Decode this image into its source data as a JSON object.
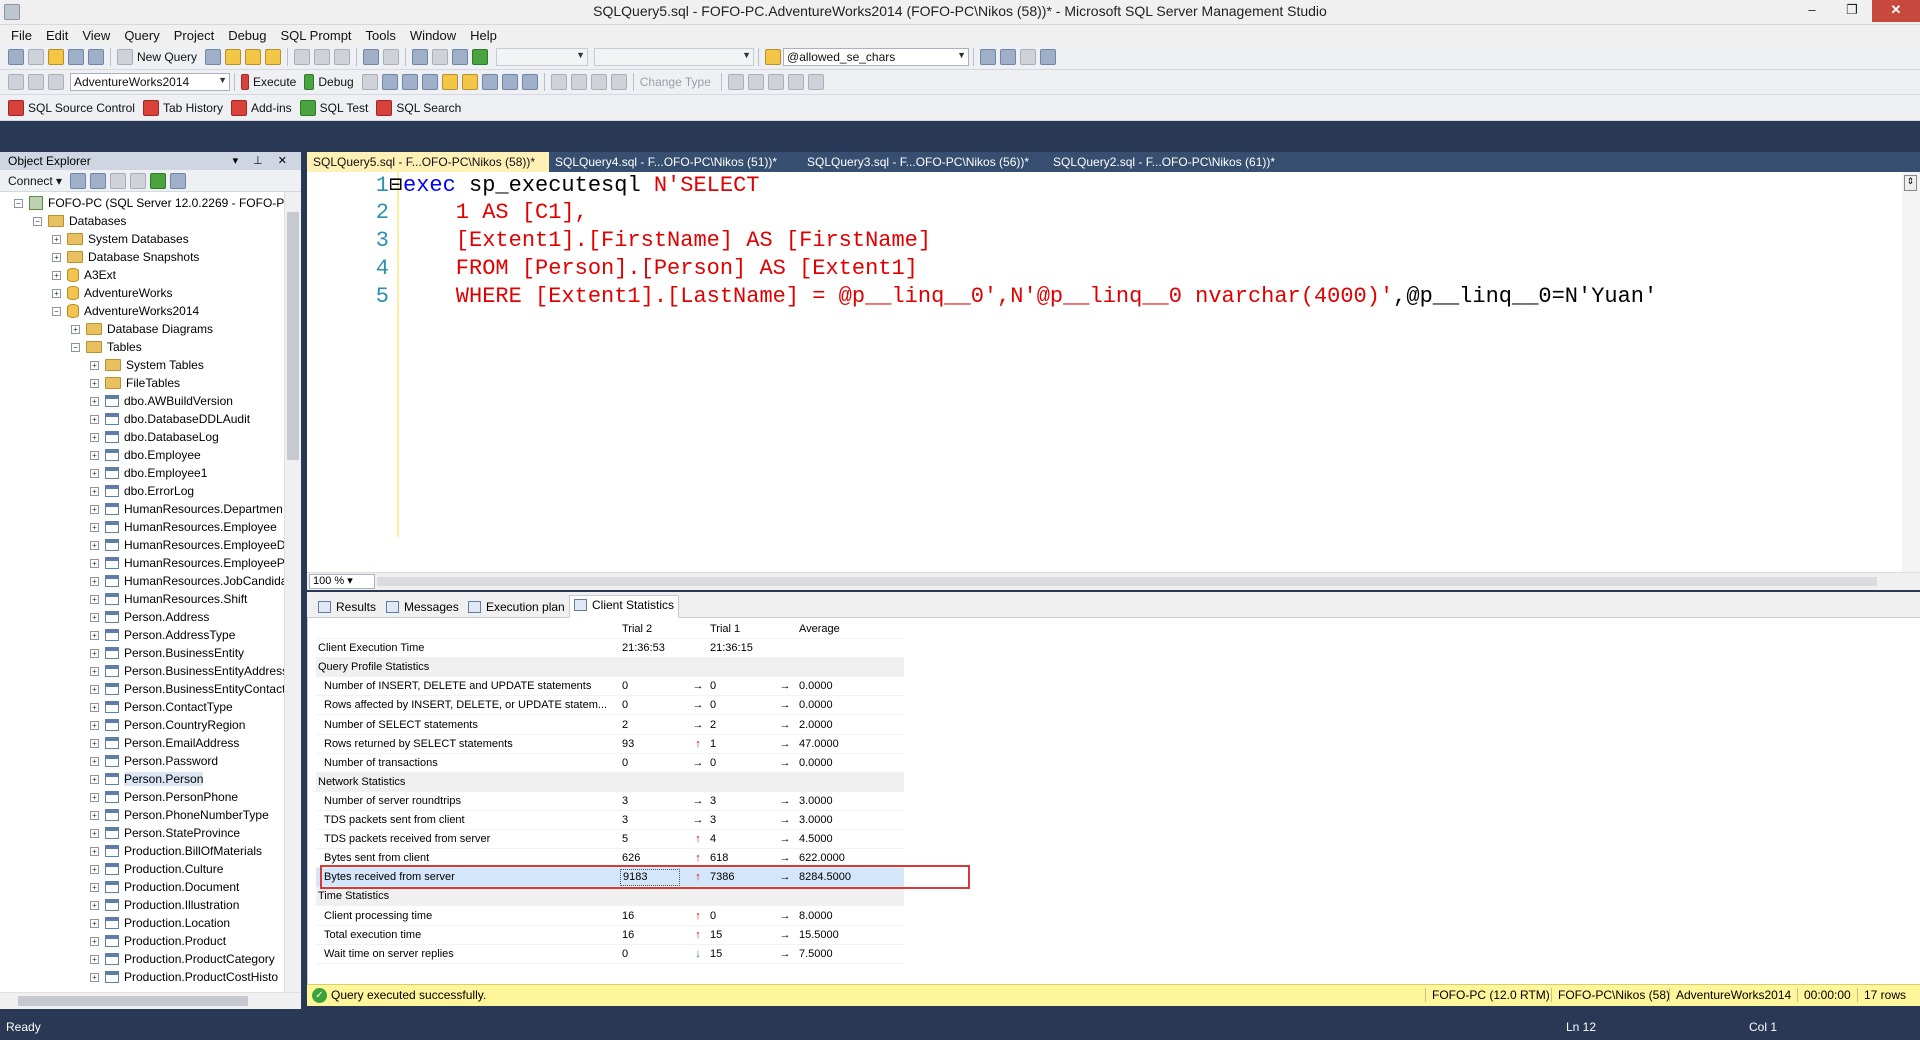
{
  "window": {
    "title": "SQLQuery5.sql - FOFO-PC.AdventureWorks2014 (FOFO-PC\\Nikos (58))* - Microsoft SQL Server Management Studio"
  },
  "menu": [
    "File",
    "Edit",
    "View",
    "Query",
    "Project",
    "Debug",
    "SQL Prompt",
    "Tools",
    "Window",
    "Help"
  ],
  "toolbar1": {
    "new_query": "New Query",
    "search_combo": "@allowed_se_chars"
  },
  "toolbar2": {
    "database": "AdventureWorks2014",
    "execute": "Execute",
    "debug": "Debug",
    "change_type": "Change Type"
  },
  "toolbar3": {
    "source_control": "SQL Source Control",
    "tab_history": "Tab History",
    "addins": "Add-ins",
    "sql_test": "SQL Test",
    "sql_search": "SQL Search"
  },
  "object_explorer": {
    "title": "Object Explorer",
    "connect": "Connect",
    "tree": [
      {
        "label": "FOFO-PC (SQL Server 12.0.2269 - FOFO-PC\\N",
        "level": 0,
        "icon": "server-icon",
        "exp": "−"
      },
      {
        "label": "Databases",
        "level": 1,
        "icon": "folder-icon",
        "exp": "−"
      },
      {
        "label": "System Databases",
        "level": 2,
        "icon": "folder-icon",
        "exp": "+"
      },
      {
        "label": "Database Snapshots",
        "level": 2,
        "icon": "folder-icon",
        "exp": "+"
      },
      {
        "label": "A3Ext",
        "level": 2,
        "icon": "database-icon",
        "exp": "+"
      },
      {
        "label": "AdventureWorks",
        "level": 2,
        "icon": "database-icon",
        "exp": "+"
      },
      {
        "label": "AdventureWorks2014",
        "level": 2,
        "icon": "database-icon",
        "exp": "−"
      },
      {
        "label": "Database Diagrams",
        "level": 3,
        "icon": "folder-icon",
        "exp": "+"
      },
      {
        "label": "Tables",
        "level": 3,
        "icon": "folder-icon",
        "exp": "−"
      },
      {
        "label": "System Tables",
        "level": 4,
        "icon": "folder-icon",
        "exp": "+"
      },
      {
        "label": "FileTables",
        "level": 4,
        "icon": "folder-icon",
        "exp": "+"
      },
      {
        "label": "dbo.AWBuildVersion",
        "level": 4,
        "icon": "table-icon",
        "exp": "+"
      },
      {
        "label": "dbo.DatabaseDDLAudit",
        "level": 4,
        "icon": "table-icon",
        "exp": "+"
      },
      {
        "label": "dbo.DatabaseLog",
        "level": 4,
        "icon": "table-icon",
        "exp": "+"
      },
      {
        "label": "dbo.Employee",
        "level": 4,
        "icon": "table-icon",
        "exp": "+"
      },
      {
        "label": "dbo.Employee1",
        "level": 4,
        "icon": "table-icon",
        "exp": "+"
      },
      {
        "label": "dbo.ErrorLog",
        "level": 4,
        "icon": "table-icon",
        "exp": "+"
      },
      {
        "label": "HumanResources.Departmen",
        "level": 4,
        "icon": "table-icon",
        "exp": "+"
      },
      {
        "label": "HumanResources.Employee",
        "level": 4,
        "icon": "table-icon",
        "exp": "+"
      },
      {
        "label": "HumanResources.EmployeeD",
        "level": 4,
        "icon": "table-icon",
        "exp": "+"
      },
      {
        "label": "HumanResources.EmployeeP",
        "level": 4,
        "icon": "table-icon",
        "exp": "+"
      },
      {
        "label": "HumanResources.JobCandida",
        "level": 4,
        "icon": "table-icon",
        "exp": "+"
      },
      {
        "label": "HumanResources.Shift",
        "level": 4,
        "icon": "table-icon",
        "exp": "+"
      },
      {
        "label": "Person.Address",
        "level": 4,
        "icon": "table-icon",
        "exp": "+"
      },
      {
        "label": "Person.AddressType",
        "level": 4,
        "icon": "table-icon",
        "exp": "+"
      },
      {
        "label": "Person.BusinessEntity",
        "level": 4,
        "icon": "table-icon",
        "exp": "+"
      },
      {
        "label": "Person.BusinessEntityAddress",
        "level": 4,
        "icon": "table-icon",
        "exp": "+"
      },
      {
        "label": "Person.BusinessEntityContact",
        "level": 4,
        "icon": "table-icon",
        "exp": "+"
      },
      {
        "label": "Person.ContactType",
        "level": 4,
        "icon": "table-icon",
        "exp": "+"
      },
      {
        "label": "Person.CountryRegion",
        "level": 4,
        "icon": "table-icon",
        "exp": "+"
      },
      {
        "label": "Person.EmailAddress",
        "level": 4,
        "icon": "table-icon",
        "exp": "+"
      },
      {
        "label": "Person.Password",
        "level": 4,
        "icon": "table-icon",
        "exp": "+"
      },
      {
        "label": "Person.Person",
        "level": 4,
        "icon": "table-icon",
        "exp": "+"
      },
      {
        "label": "Person.PersonPhone",
        "level": 4,
        "icon": "table-icon",
        "exp": "+"
      },
      {
        "label": "Person.PhoneNumberType",
        "level": 4,
        "icon": "table-icon",
        "exp": "+"
      },
      {
        "label": "Person.StateProvince",
        "level": 4,
        "icon": "table-icon",
        "exp": "+"
      },
      {
        "label": "Production.BillOfMaterials",
        "level": 4,
        "icon": "table-icon",
        "exp": "+"
      },
      {
        "label": "Production.Culture",
        "level": 4,
        "icon": "table-icon",
        "exp": "+"
      },
      {
        "label": "Production.Document",
        "level": 4,
        "icon": "table-icon",
        "exp": "+"
      },
      {
        "label": "Production.Illustration",
        "level": 4,
        "icon": "table-icon",
        "exp": "+"
      },
      {
        "label": "Production.Location",
        "level": 4,
        "icon": "table-icon",
        "exp": "+"
      },
      {
        "label": "Production.Product",
        "level": 4,
        "icon": "table-icon",
        "exp": "+"
      },
      {
        "label": "Production.ProductCategory",
        "level": 4,
        "icon": "table-icon",
        "exp": "+"
      },
      {
        "label": "Production.ProductCostHisto",
        "level": 4,
        "icon": "table-icon",
        "exp": "+"
      }
    ]
  },
  "doc_tabs": [
    {
      "label": "SQLQuery5.sql - F...OFO-PC\\Nikos (58))*",
      "active": true
    },
    {
      "label": "SQLQuery4.sql - F...OFO-PC\\Nikos (51))*",
      "active": false
    },
    {
      "label": "SQLQuery3.sql - F...OFO-PC\\Nikos (56))*",
      "active": false
    },
    {
      "label": "SQLQuery2.sql - F...OFO-PC\\Nikos (61))*",
      "active": false
    }
  ],
  "editor": {
    "lines": [
      {
        "n": "1",
        "kw": "exec",
        "blk": " sp_executesql",
        "red": " N'SELECT",
        "rest": ""
      },
      {
        "n": "2",
        "kw": "",
        "blk": "",
        "red": "    1 AS [C1],",
        "rest": ""
      },
      {
        "n": "3",
        "kw": "",
        "blk": "",
        "red": "    [Extent1].[FirstName] AS [FirstName]",
        "rest": ""
      },
      {
        "n": "4",
        "kw": "",
        "blk": "",
        "red": "    FROM [Person].[Person] AS [Extent1]",
        "rest": ""
      },
      {
        "n": "5",
        "kw": "",
        "blk": "",
        "red": "    WHERE [Extent1].[LastName] = @p__linq__0',N'@p__linq__0 nvarchar(4000)'",
        "rest": ",@p__linq__0=N'Yuan'"
      }
    ],
    "zoom": "100 %"
  },
  "result_tabs": [
    {
      "label": "Results",
      "active": false
    },
    {
      "label": "Messages",
      "active": false
    },
    {
      "label": "Execution plan",
      "active": false
    },
    {
      "label": "Client Statistics",
      "active": true
    }
  ],
  "client_statistics": {
    "headers": [
      "Trial 2",
      "Trial 1",
      "Average"
    ],
    "rows": [
      {
        "type": "item0",
        "label": "Client Execution Time",
        "t2": "21:36:53",
        "a1": "",
        "t1": "21:36:15",
        "a2": "",
        "avg": ""
      },
      {
        "type": "section",
        "label": "Query Profile Statistics"
      },
      {
        "type": "item",
        "label": "Number of INSERT, DELETE and UPDATE statements",
        "t2": "0",
        "a1": "→",
        "t1": "0",
        "a2": "→",
        "avg": "0.0000"
      },
      {
        "type": "item",
        "label": "Rows affected by INSERT, DELETE, or UPDATE statem...",
        "t2": "0",
        "a1": "→",
        "t1": "0",
        "a2": "→",
        "avg": "0.0000"
      },
      {
        "type": "item",
        "label": "Number of SELECT statements",
        "t2": "2",
        "a1": "→",
        "t1": "2",
        "a2": "→",
        "avg": "2.0000"
      },
      {
        "type": "item",
        "label": "Rows returned by SELECT statements",
        "t2": "93",
        "a1": "↑",
        "t1": "1",
        "a2": "→",
        "avg": "47.0000"
      },
      {
        "type": "item",
        "label": "Number of transactions",
        "t2": "0",
        "a1": "→",
        "t1": "0",
        "a2": "→",
        "avg": "0.0000"
      },
      {
        "type": "section",
        "label": "Network Statistics"
      },
      {
        "type": "item",
        "label": "Number of server roundtrips",
        "t2": "3",
        "a1": "→",
        "t1": "3",
        "a2": "→",
        "avg": "3.0000"
      },
      {
        "type": "item",
        "label": "TDS packets sent from client",
        "t2": "3",
        "a1": "→",
        "t1": "3",
        "a2": "→",
        "avg": "3.0000"
      },
      {
        "type": "item",
        "label": "TDS packets received from server",
        "t2": "5",
        "a1": "↑",
        "t1": "4",
        "a2": "→",
        "avg": "4.5000"
      },
      {
        "type": "item",
        "label": "Bytes sent from client",
        "t2": "626",
        "a1": "↑",
        "t1": "618",
        "a2": "→",
        "avg": "622.0000"
      },
      {
        "type": "highlight",
        "label": "Bytes received from server",
        "t2": "9183",
        "a1": "↑",
        "t1": "7386",
        "a2": "→",
        "avg": "8284.5000"
      },
      {
        "type": "section",
        "label": "Time Statistics"
      },
      {
        "type": "item",
        "label": "Client processing time",
        "t2": "16",
        "a1": "↑",
        "t1": "0",
        "a2": "→",
        "avg": "8.0000"
      },
      {
        "type": "item",
        "label": "Total execution time",
        "t2": "16",
        "a1": "↑",
        "t1": "15",
        "a2": "→",
        "avg": "15.5000"
      },
      {
        "type": "item",
        "label": "Wait time on server replies",
        "t2": "0",
        "a1": "↓",
        "t1": "15",
        "a2": "→",
        "avg": "7.5000"
      }
    ]
  },
  "query_status": {
    "message": "Query executed successfully.",
    "server": "FOFO-PC (12.0 RTM)",
    "user": "FOFO-PC\\Nikos (58)",
    "database": "AdventureWorks2014",
    "elapsed": "00:00:00",
    "rows": "17 rows"
  },
  "status_bar": {
    "ready": "Ready",
    "ln": "Ln 12",
    "col": "Col 1"
  },
  "colors": {
    "chrome": "#293955",
    "active_tab": "#fff1b6",
    "status_yellow": "#fff59b",
    "highlight_box": "#d83a3a"
  }
}
